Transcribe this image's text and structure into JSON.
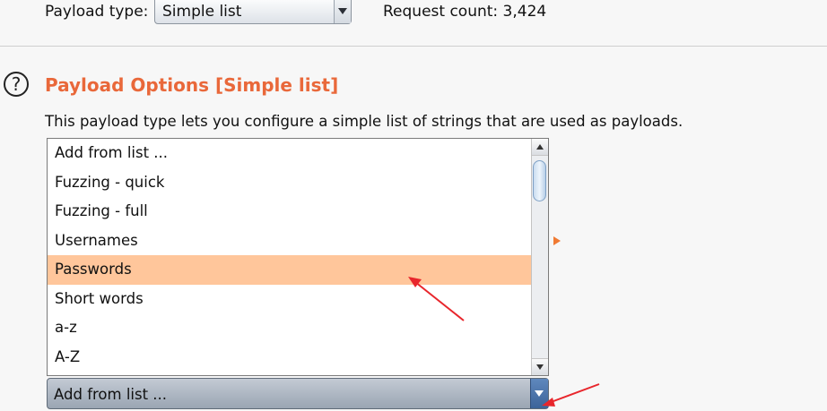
{
  "payload_type": {
    "label": "Payload type:",
    "selected": "Simple list"
  },
  "request_count": "Request count: 3,424",
  "payload_options": {
    "title": "Payload Options [Simple list]",
    "description": "This payload type lets you configure a simple list of strings that are used as payloads."
  },
  "add_from_list": {
    "items": [
      "Add from list ...",
      "Fuzzing - quick",
      "Fuzzing - full",
      "Usernames",
      "Passwords",
      "Short words",
      "a-z",
      "A-Z"
    ],
    "highlighted_item": "Passwords",
    "combo_value": "Add from list ..."
  },
  "colors": {
    "accent_title": "#e9683a",
    "highlight": "#ffc69b",
    "annotation_arrow": "#e8262c"
  },
  "icons": {
    "help": "question-circle-icon",
    "dropdown": "chevron-down-icon",
    "marker": "orange-triangle-icon"
  }
}
